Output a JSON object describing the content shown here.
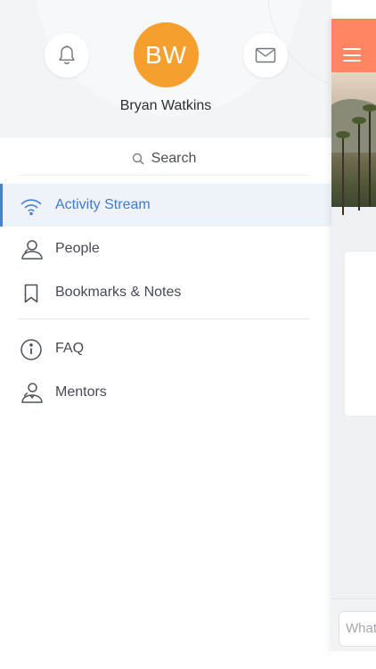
{
  "profile": {
    "initials": "BW",
    "name": "Bryan Watkins",
    "avatar_color": "#f5a02e",
    "notifications_icon": "bell-icon",
    "messages_icon": "mail-icon"
  },
  "search": {
    "label": "Search",
    "icon": "search-icon"
  },
  "nav": {
    "active_color": "#3f7bd0",
    "items": [
      {
        "label": "Activity Stream",
        "icon": "wifi-signal-icon",
        "active": true
      },
      {
        "label": "People",
        "icon": "person-icon",
        "active": false
      },
      {
        "label": "Bookmarks & Notes",
        "icon": "bookmark-icon",
        "active": false
      },
      {
        "label": "FAQ",
        "icon": "info-icon",
        "active": false
      },
      {
        "label": "Mentors",
        "icon": "mentor-icon",
        "active": false
      }
    ]
  },
  "main": {
    "header_color": "#ff8660",
    "menu_icon": "hamburger-icon",
    "composer_placeholder": "What"
  }
}
